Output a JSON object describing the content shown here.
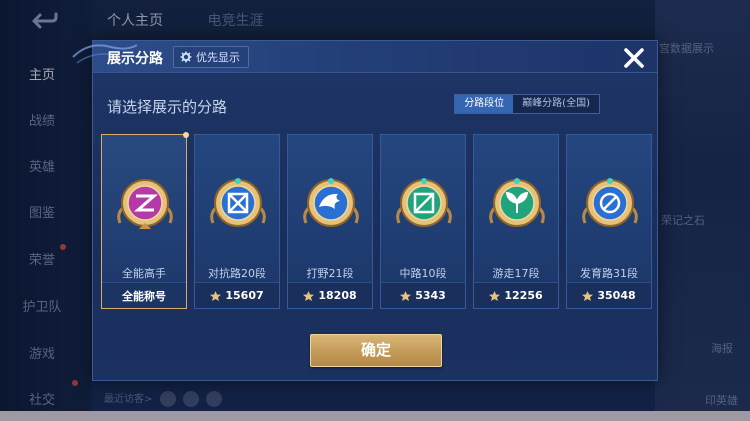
{
  "background": {
    "top_tabs": [
      "个人主页",
      "电竞生涯"
    ],
    "nav": [
      "主页",
      "战绩",
      "英雄",
      "图鉴",
      "荣誉",
      "护卫队",
      "游戏",
      "社交"
    ],
    "recent_visitors": "最近访客>",
    "right_labels": [
      "宫数据展示",
      "荣记之石",
      "海报",
      "印英雄"
    ]
  },
  "modal": {
    "title": "展示分路",
    "priority_button": "优先显示",
    "subtitle": "请选择展示的分路",
    "segment": {
      "active": "分路段位",
      "inactive": "巅峰分路(全国)"
    },
    "cards": [
      {
        "label": "全能高手",
        "footer": "全能称号",
        "score": "",
        "emblem": "allround-emblem-icon",
        "selected": true
      },
      {
        "label": "对抗路20段",
        "footer": "",
        "score": "15607",
        "emblem": "clash-lane-emblem-icon",
        "selected": false
      },
      {
        "label": "打野21段",
        "footer": "",
        "score": "18208",
        "emblem": "jungle-emblem-icon",
        "selected": false
      },
      {
        "label": "中路10段",
        "footer": "",
        "score": "5343",
        "emblem": "mid-lane-emblem-icon",
        "selected": false
      },
      {
        "label": "游走17段",
        "footer": "",
        "score": "12256",
        "emblem": "roam-emblem-icon",
        "selected": false
      },
      {
        "label": "发育路31段",
        "footer": "",
        "score": "35048",
        "emblem": "farm-lane-emblem-icon",
        "selected": false
      }
    ],
    "confirm_button": "确定"
  },
  "colors": {
    "gold": "#d8ad6c",
    "accent_blue": "#3566b4"
  }
}
